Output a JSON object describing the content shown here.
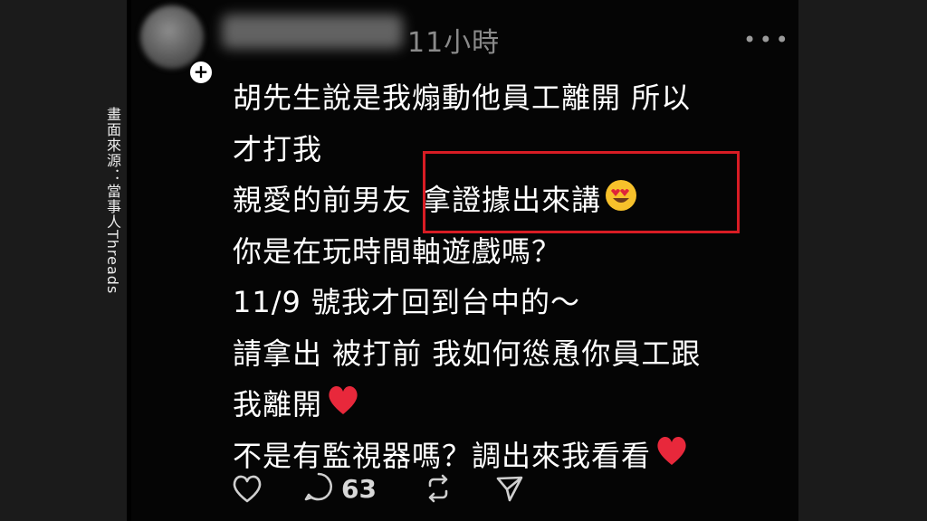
{
  "watermark": {
    "source_credit": "畫面來源：當事人Threads"
  },
  "post": {
    "time_ago": "11小時",
    "more_icon": "more-horizontal-icon",
    "follow_icon": "plus-icon",
    "lines": [
      "胡先生說是我煽動他員工離開 所以",
      "才打我",
      "親愛的前男友 拿證據出來講",
      "你是在玩時間軸遊戲嗎？",
      "11/9 號我才回到台中的～",
      "請拿出 被打前 我如何慫恿你員工跟",
      "我離開",
      "不是有監視器嗎？調出來我看看"
    ],
    "emojis": {
      "line3": "heart-eyes-emoji",
      "line7": "red-heart-emoji",
      "line8": "red-heart-emoji"
    },
    "actions": {
      "like_icon": "heart-icon",
      "reply_icon": "comment-icon",
      "reply_count": "63",
      "repost_icon": "repost-icon",
      "share_icon": "send-icon"
    }
  },
  "colors": {
    "highlight_box": "#d81c24",
    "panel": "#1b1b1b",
    "background": "#050505"
  }
}
